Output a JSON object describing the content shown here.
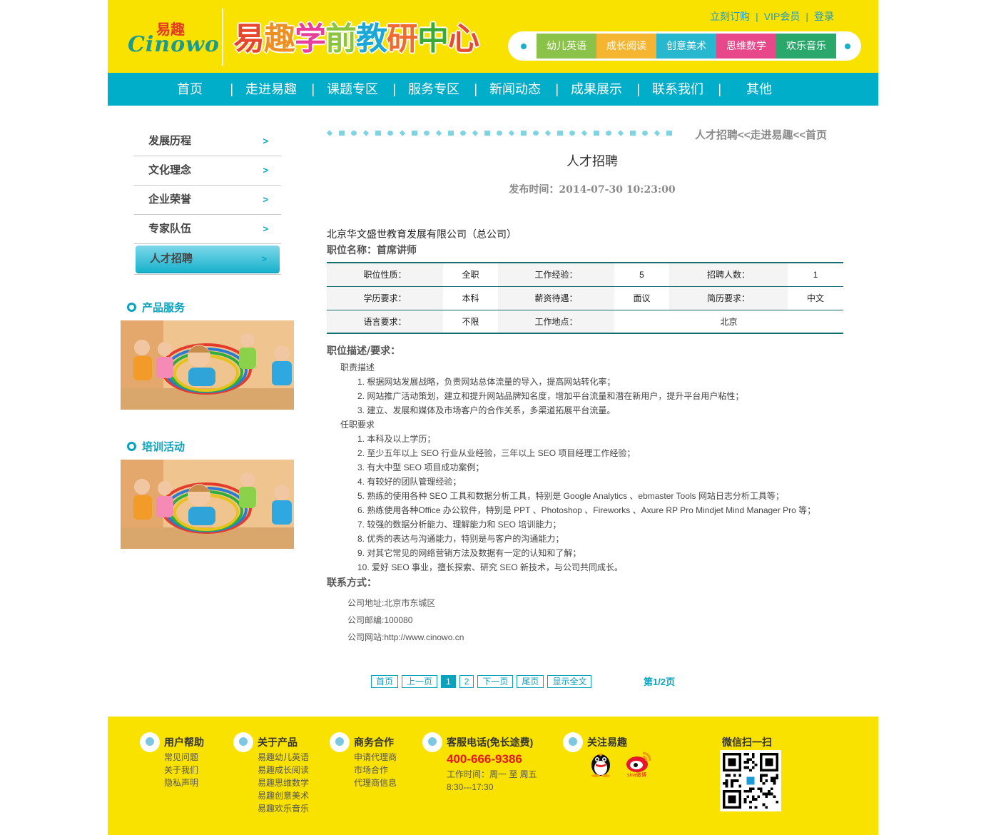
{
  "header": {
    "logo_cn": "易趣",
    "logo_en": "Cinowo",
    "banner_title": [
      "易",
      "趣",
      "学",
      "前",
      "教",
      "研",
      "中",
      "心"
    ],
    "banner_colors": [
      "#e8452d",
      "#f08f21",
      "#e6409a",
      "#8bc53f",
      "#1ba8d6",
      "#ef6b2f",
      "#3aaa35",
      "#e54b2f"
    ],
    "top_links": [
      "立刻订购",
      "VIP会员",
      "登录"
    ],
    "top_sep": "|",
    "categories": [
      {
        "label": "幼儿英语",
        "color": "#8bc34a"
      },
      {
        "label": "成长阅读",
        "color": "#f6b531"
      },
      {
        "label": "创意美术",
        "color": "#27b8d0"
      },
      {
        "label": "思维数学",
        "color": "#e8488a"
      },
      {
        "label": "欢乐音乐",
        "color": "#2aa86c"
      }
    ]
  },
  "nav": {
    "items": [
      "首页",
      "走进易趣",
      "课题专区",
      "服务专区",
      "新闻动态",
      "成果展示",
      "联系我们",
      "其他"
    ],
    "sep": "|"
  },
  "sidebar": {
    "items": [
      "发展历程",
      "文化理念",
      "企业荣誉",
      "专家队伍",
      "人才招聘"
    ],
    "active_index": 4,
    "arrow": ">",
    "product_title": "产品服务",
    "training_title": "培训活动"
  },
  "breadcrumb": "人才招聘<<走进易趣<<首页",
  "article": {
    "title": "人才招聘",
    "time": "发布时间：2014-07-30 10:23:00",
    "company": "北京华文盛世教育发展有限公司（总公司）",
    "position": "职位名称：首席讲师",
    "table": [
      [
        "职位性质：",
        "全职",
        "工作经验：",
        "5",
        "招聘人数：",
        "1"
      ],
      [
        "学历要求：",
        "本科",
        "薪资待遇：",
        "面议",
        "简历要求：",
        "中文"
      ],
      [
        "语言要求：",
        "不限",
        "工作地点：",
        "北京"
      ]
    ],
    "desc_heading": "职位描述/要求：",
    "sections": [
      {
        "title": "职责描述",
        "lines": [
          "1. 根据网站发展战略，负责网站总体流量的导入，提高网站转化率；",
          "2. 网站推广活动策划，建立和提升网站品牌知名度，增加平台流量和潜在新用户，提升平台用户粘性；",
          "3. 建立、发展和媒体及市场客户的合作关系，多渠道拓展平台流量。"
        ]
      },
      {
        "title": "任职要求",
        "lines": [
          "1. 本科及以上学历；",
          "2. 至少五年以上 SEO 行业从业经验，三年以上 SEO 项目经理工作经验；",
          "3. 有大中型 SEO 项目成功案例；",
          "4. 有较好的团队管理经验；",
          "5. 熟练的使用各种 SEO 工具和数据分析工具，特别是 Google Analytics 、ebmaster Tools 网站日志分析工具等；",
          "6. 熟练使用各种Office 办公软件，特别是 PPT 、Photoshop 、Fireworks 、Axure RP Pro Mindjet Mind Manager Pro 等；",
          "7. 较强的数据分析能力、理解能力和 SEO 培训能力；",
          "8. 优秀的表达与沟通能力，特别是与客户的沟通能力；",
          "9. 对其它常见的网络营销方法及数据有一定的认知和了解；",
          "10. 爱好 SEO 事业，擅长探索、研究 SEO 新技术，与公司共同成长。"
        ]
      }
    ],
    "contact_heading": "联系方式：",
    "contact": [
      "公司地址:北京市东城区",
      "公司邮编:100080",
      "公司网站:http://www.cinowo.cn"
    ]
  },
  "pager": {
    "buttons": [
      "首页",
      "上一页",
      "1",
      "2",
      "下一页",
      "尾页",
      "显示全文"
    ],
    "current": "1",
    "info": "第1/2页"
  },
  "footer": {
    "help": {
      "title": "用户帮助",
      "links": [
        "常见问题",
        "关于我们",
        "隐私声明"
      ]
    },
    "products": {
      "title": "关于产品",
      "links": [
        "易趣幼儿英语",
        "易趣成长阅读",
        "易趣思维数学",
        "易趣创意美术",
        "易趣欢乐音乐"
      ]
    },
    "business": {
      "title": "商务合作",
      "links": [
        "申请代理商",
        "市场合作",
        "代理商信息"
      ]
    },
    "service": {
      "title": "客服电话(免长途费)",
      "phone": "400-666-9386",
      "hours1": "工作时间：周一 至 周五",
      "hours2": "8:30---17:30"
    },
    "follow": {
      "title": "关注易趣",
      "weibo_label": "sina微博"
    },
    "qr_title": "微信扫一扫"
  }
}
